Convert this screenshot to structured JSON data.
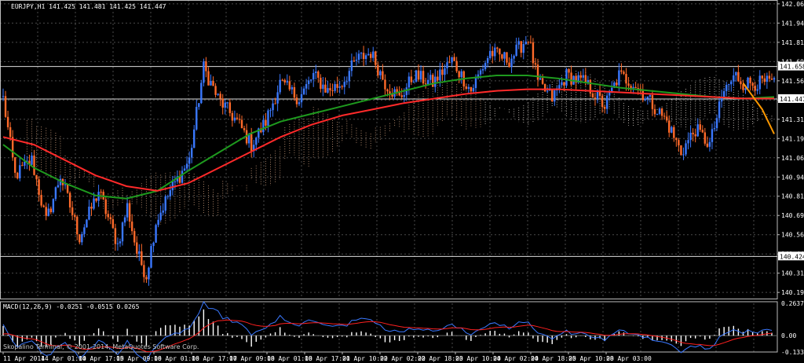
{
  "header": {
    "symbol_line": "EURJPY,H1  141.425 141.481 141.425 141.447",
    "macd_line": "MACD(12,26,9) -0.0251 -0.0515 0.0265",
    "copyright": "Skopalino Terminal, © 2001-2014, MetaQuotes Software Corp."
  },
  "colors": {
    "background": "#000000",
    "grid": "#4a4a4a",
    "bull": "#3a78ff",
    "bear": "#ff6a2a",
    "ema_red": "#ff2a2a",
    "ma_green": "#1e9a1e",
    "cloud": "#c89a7a",
    "cloud_light": "#d8d0c8",
    "forecast": "#ff9900",
    "macd_hist": "#ffffff",
    "macd_signal": "#ff2020",
    "macd_main": "#3a78ff"
  },
  "chart_data": [
    {
      "type": "candlestick",
      "symbol": "EURJPY",
      "timeframe": "H1",
      "ylim": [
        140.15,
        142.09
      ],
      "y_ticks": [
        "142.065",
        "141.940",
        "141.815",
        "141.690",
        "141.565",
        "141.440",
        "141.315",
        "141.190",
        "141.065",
        "140.940",
        "140.815",
        "140.690",
        "140.565",
        "140.440",
        "140.315",
        "140.190"
      ],
      "x_ticks": [
        "11 Apr 2014",
        "14 Apr 01:00",
        "14 Apr 17:00",
        "15 Apr 09:00",
        "16 Apr 01:00",
        "16 Apr 17:00",
        "17 Apr 09:00",
        "18 Apr 01:00",
        "18 Apr 17:00",
        "21 Apr 10:00",
        "22 Apr 02:00",
        "22 Apr 18:00",
        "23 Apr 10:00",
        "24 Apr 02:00",
        "24 Apr 18:00",
        "25 Apr 10:00",
        "28 Apr 03:00"
      ],
      "horizontal_levels": [
        {
          "value": 141.658,
          "label": "141.658"
        },
        {
          "value": 141.447,
          "label": "141.447"
        },
        {
          "value": 140.424,
          "label": "140.424"
        }
      ],
      "anchors": [
        [
          0,
          141.45
        ],
        [
          5,
          140.95
        ],
        [
          12,
          141.05
        ],
        [
          18,
          140.65
        ],
        [
          24,
          140.95
        ],
        [
          32,
          140.55
        ],
        [
          40,
          140.85
        ],
        [
          48,
          140.5
        ],
        [
          52,
          140.75
        ],
        [
          56,
          140.45
        ],
        [
          60,
          140.3
        ],
        [
          64,
          140.65
        ],
        [
          70,
          140.85
        ],
        [
          78,
          141.05
        ],
        [
          84,
          141.65
        ],
        [
          90,
          141.45
        ],
        [
          98,
          141.3
        ],
        [
          104,
          141.15
        ],
        [
          110,
          141.3
        ],
        [
          116,
          141.55
        ],
        [
          124,
          141.45
        ],
        [
          130,
          141.6
        ],
        [
          136,
          141.5
        ],
        [
          142,
          141.55
        ],
        [
          148,
          141.7
        ],
        [
          154,
          141.75
        ],
        [
          160,
          141.55
        ],
        [
          166,
          141.45
        ],
        [
          172,
          141.6
        ],
        [
          180,
          141.55
        ],
        [
          188,
          141.7
        ],
        [
          196,
          141.5
        ],
        [
          204,
          141.75
        ],
        [
          212,
          141.7
        ],
        [
          220,
          141.85
        ],
        [
          224,
          141.55
        ],
        [
          230,
          141.45
        ],
        [
          236,
          141.6
        ],
        [
          244,
          141.55
        ],
        [
          252,
          141.4
        ],
        [
          258,
          141.6
        ],
        [
          264,
          141.55
        ],
        [
          270,
          141.45
        ],
        [
          278,
          141.3
        ],
        [
          284,
          141.1
        ],
        [
          290,
          141.25
        ],
        [
          296,
          141.15
        ],
        [
          302,
          141.5
        ],
        [
          307,
          141.6
        ],
        [
          310,
          141.55
        ]
      ],
      "forecast_path": [
        [
          310,
          141.55
        ],
        [
          318,
          141.38
        ],
        [
          323,
          141.22
        ]
      ],
      "ema_red": [
        141.2,
        141.15,
        141.05,
        140.95,
        140.88,
        140.85,
        140.9,
        141.0,
        141.1,
        141.2,
        141.28,
        141.34,
        141.38,
        141.42,
        141.45,
        141.48,
        141.5,
        141.51,
        141.51,
        141.5,
        141.49,
        141.48,
        141.47,
        141.46,
        141.45,
        141.45
      ],
      "ma_green": [
        141.15,
        141.0,
        140.9,
        140.82,
        140.8,
        140.85,
        140.98,
        141.1,
        141.22,
        141.3,
        141.35,
        141.4,
        141.45,
        141.5,
        141.55,
        141.58,
        141.6,
        141.6,
        141.58,
        141.55,
        141.52,
        141.5,
        141.48,
        141.46,
        141.45,
        141.46
      ]
    },
    {
      "type": "bar",
      "name": "MACD(12,26,9)",
      "values_text": {
        "main": "-0.0251",
        "signal": "-0.0515",
        "histogram": "0.0265"
      },
      "ylim": [
        -0.1333,
        0.2637
      ],
      "y_ticks": [
        "0.2637",
        "0.00",
        "-0.1333"
      ]
    }
  ]
}
